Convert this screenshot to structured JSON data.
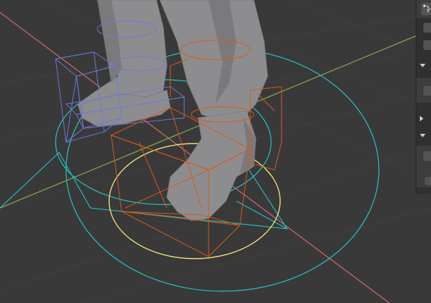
{
  "app": {
    "editor": "3D Viewport"
  },
  "viewport": {
    "background": "#393939",
    "grid_color": "#3f3f3f",
    "x_axis_color": "#c56b6b",
    "y_axis_color": "#8aa04a",
    "mesh_color": "#8d8d8f",
    "bone_selected_color": "#d85a1a",
    "bone_unselected_color": "#6f78d8",
    "control_circle_color": "#22c7cc",
    "active_circle_color": "#f2e27a"
  },
  "side_panel": {
    "icons": [
      {
        "name": "cursor-tool-icon"
      },
      {
        "name": "tool-icon-1"
      },
      {
        "name": "tool-icon-2"
      },
      {
        "name": "tool-icon-3"
      },
      {
        "name": "tool-icon-4"
      },
      {
        "name": "tool-icon-5"
      },
      {
        "name": "tool-icon-6"
      }
    ]
  }
}
